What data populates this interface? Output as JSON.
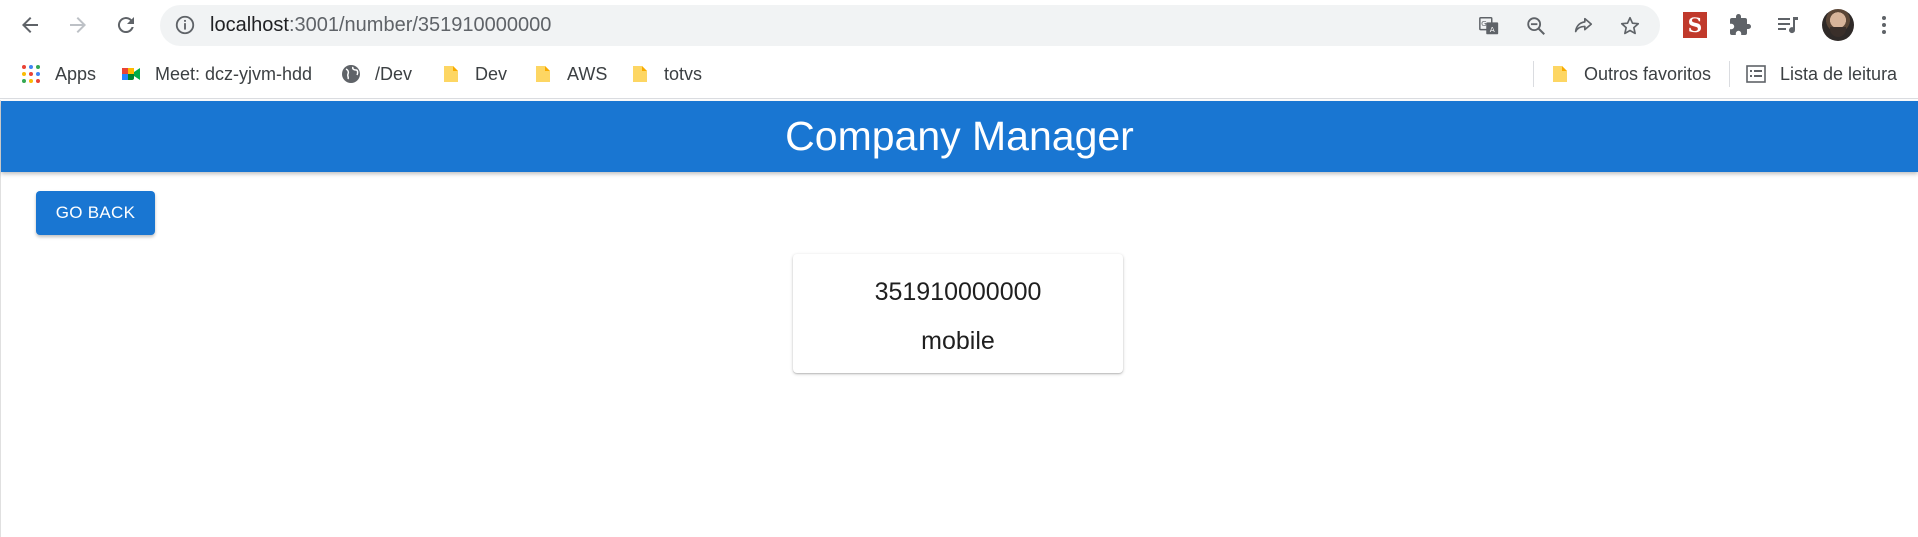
{
  "browser": {
    "url_host": "localhost",
    "url_rest": ":3001/number/351910000000",
    "icons": [
      "back-arrow-icon",
      "forward-arrow-icon",
      "reload-icon",
      "info-icon",
      "translate-icon",
      "zoom-out-icon",
      "share-icon",
      "star-icon",
      "extension-s-icon",
      "puzzle-icon",
      "media-queue-icon",
      "avatar",
      "more-vert-icon"
    ],
    "extension_letter": "S"
  },
  "bookmarks": {
    "apps": "Apps",
    "meet": "Meet: dcz-yjvm-hdd",
    "dev_link": "/Dev",
    "dev_folder": "Dev",
    "aws": "AWS",
    "totvs": "totvs",
    "other": "Outros favoritos",
    "reading_list": "Lista de leitura"
  },
  "app": {
    "title": "Company Manager",
    "go_back": "GO BACK",
    "accent": "#1976d2"
  },
  "card": {
    "number": "351910000000",
    "type": "mobile"
  }
}
